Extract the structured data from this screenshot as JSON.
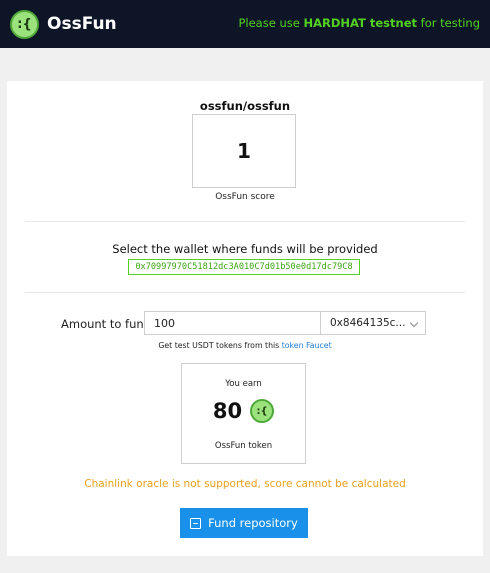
{
  "header": {
    "logo_glyph": ":{",
    "brand": "OssFun",
    "notice_prefix": "Please use ",
    "notice_strong": "HARDHAT testnet",
    "notice_suffix": " for testing"
  },
  "repo": {
    "name": "ossfun/ossfun",
    "score": "1",
    "score_label": "OssFun score"
  },
  "wallet": {
    "title": "Select the wallet where funds will be provided",
    "address": "0x70997970C51812dc3A010C7d01b50e0d17dc79C8"
  },
  "fund_form": {
    "amount_label": "Amount to fund",
    "amount_value": "100",
    "token_selected": "0x8464135c...",
    "faucet_prefix": "Get test USDT tokens from this ",
    "faucet_link": "token Faucet"
  },
  "earn": {
    "label": "You earn",
    "amount": "80",
    "token_glyph": ":{",
    "token_name": "OssFun token"
  },
  "warning": "Chainlink oracle is not supported, score cannot be calculated",
  "fund_button": "Fund repository",
  "colors": {
    "topbar": "#0d1527",
    "accent_green": "#52d21f",
    "primary_blue": "#1990ea",
    "warning_orange": "#e6a11a"
  }
}
